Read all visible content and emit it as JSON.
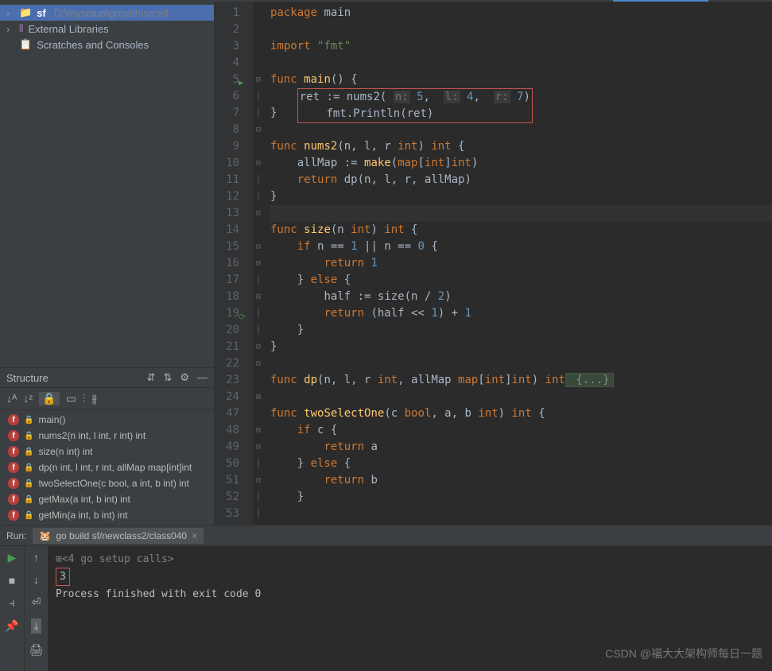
{
  "project": {
    "root_name": "sf",
    "root_path": "D:\\mysetup\\gopath\\src\\sf",
    "external_libs": "External Libraries",
    "scratches": "Scratches and Consoles"
  },
  "structure": {
    "title": "Structure",
    "functions": [
      "main()",
      "nums2(n int, l int, r int) int",
      "size(n int) int",
      "dp(n int, l int, r int, allMap map[int]int",
      "twoSelectOne(c bool, a int, b int) int",
      "getMax(a int, b int) int",
      "getMin(a int, b int) int"
    ]
  },
  "editor": {
    "line_numbers": [
      "1",
      "2",
      "3",
      "4",
      "5",
      "6",
      "7",
      "8",
      "9",
      "10",
      "11",
      "12",
      "13",
      "14",
      "15",
      "16",
      "17",
      "18",
      "19",
      "20",
      "21",
      "22",
      "23",
      "24",
      "47",
      "48",
      "49",
      "50",
      "51",
      "52",
      "53"
    ],
    "code": {
      "l1": {
        "kw": "package",
        "id": " main"
      },
      "l3": {
        "kw": "import",
        "str": " \"fmt\""
      },
      "l5": {
        "kw": "func ",
        "fn": "main",
        "rest": "() {"
      },
      "l6": {
        "id1": "ret ",
        "op": ":= ",
        "call": "nums2",
        "open": "( ",
        "p1": "n:",
        "n1": " 5",
        "c1": ",  ",
        "p2": "l:",
        "n2": " 4",
        "c2": ",  ",
        "p3": "r:",
        "n3": " 7",
        "close": ")"
      },
      "l7": {
        "pkg": "fmt",
        "dot": ".",
        "call": "Println",
        "args": "(ret)"
      },
      "l8": "}",
      "l10": {
        "kw": "func ",
        "fn": "nums2",
        "sig": "(n, l, r ",
        "t1": "int",
        "mid": ") ",
        "t2": "int",
        "end": " {"
      },
      "l11": {
        "id": "allMap ",
        "op": ":= ",
        "fn": "make",
        "open": "(",
        "t": "map",
        "b1": "[",
        "t2": "int",
        "b2": "]",
        "t3": "int",
        "close": ")"
      },
      "l12": {
        "kw": "return ",
        "fn": "dp",
        "args": "(n, l, r, allMap)"
      },
      "l13": "}",
      "l15": {
        "kw": "func ",
        "fn": "size",
        "sig": "(n ",
        "t1": "int",
        "mid": ") ",
        "t2": "int",
        "end": " {"
      },
      "l16": {
        "kw": "if ",
        "e1": "n == ",
        "n1": "1",
        "e2": " || n == ",
        "n2": "0",
        "end": " {"
      },
      "l17": {
        "kw": "return ",
        "n": "1"
      },
      "l18": {
        "close": "} ",
        "kw": "else",
        "end": " {"
      },
      "l19": {
        "id": "half ",
        "op": ":= ",
        "fn": "size",
        "open": "(n / ",
        "n": "2",
        "close": ")"
      },
      "l20": {
        "kw": "return ",
        "e1": "(half << ",
        "n1": "1",
        "e2": ") + ",
        "n2": "1"
      },
      "l21": "    }",
      "l22": "}",
      "l24": {
        "kw": "func ",
        "fn": "dp",
        "sig": "(n, l, r ",
        "t1": "int",
        "mid": ", allMap ",
        "t2": "map",
        "b1": "[",
        "t3": "int",
        "b2": "]",
        "t4": "int",
        "mid2": ") ",
        "t5": "int",
        "fold": " {...}"
      },
      "l48": {
        "kw": "func ",
        "fn": "twoSelectOne",
        "sig": "(c ",
        "t1": "bool",
        "mid": ", a, b ",
        "t2": "int",
        "mid2": ") ",
        "t3": "int",
        "end": " {"
      },
      "l49": {
        "kw": "if ",
        "e": "c {"
      },
      "l50": {
        "kw": "return ",
        "e": "a"
      },
      "l51": {
        "close": "} ",
        "kw": "else",
        "end": " {"
      },
      "l52": {
        "kw": "return ",
        "e": "b"
      },
      "l53": "    }"
    }
  },
  "run": {
    "label": "Run:",
    "tab": "go build sf/newclass2/class040",
    "setup": "<4 go setup calls>",
    "output": "3",
    "exit": "Process finished with exit code 0"
  },
  "watermark": "CSDN @福大大架构师每日一题"
}
